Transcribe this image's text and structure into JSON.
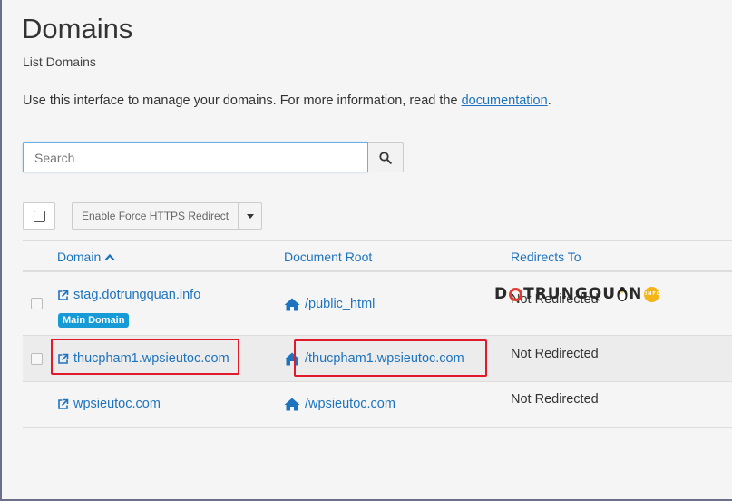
{
  "header": {
    "title": "Domains",
    "subtitle": "List Domains",
    "intro_text": "Use this interface to manage your domains. For more information, read the ",
    "intro_link": "documentation",
    "intro_end": "."
  },
  "search": {
    "placeholder": "Search",
    "value": ""
  },
  "toolbar": {
    "bulk_action_label": "Enable Force HTTPS Redirect"
  },
  "table": {
    "columns": [
      "Domain",
      "Document Root",
      "Redirects To"
    ],
    "rows": [
      {
        "domain": "stag.dotrungquan.info",
        "badge": "Main Domain",
        "document_root": "/public_html",
        "redirects_to": "Not Redirected"
      },
      {
        "domain": "thucpham1.wpsieutoc.com",
        "document_root": "/thucpham1.wpsieutoc.com",
        "redirects_to": "Not Redirected"
      },
      {
        "domain": "wpsieutoc.com",
        "document_root": "/wpsieutoc.com",
        "redirects_to": "Not Redirected"
      }
    ]
  },
  "watermark": {
    "text_parts": [
      "D",
      "TRUNGQU",
      "N"
    ],
    "suffix": "INFO"
  },
  "colors": {
    "link": "#1e73be",
    "badge": "#179bd7",
    "highlight": "#e0192b",
    "search_border": "#6aaee5"
  }
}
